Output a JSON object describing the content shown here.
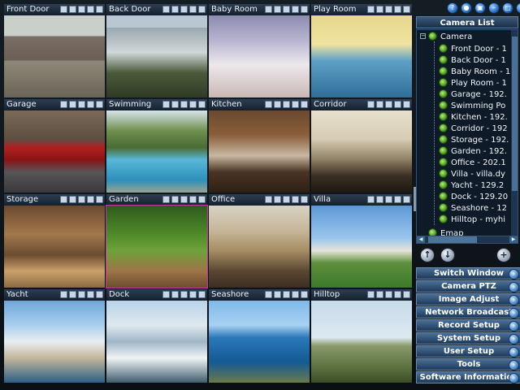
{
  "cameras": [
    {
      "name": "Front Door"
    },
    {
      "name": "Back Door"
    },
    {
      "name": "Baby Room"
    },
    {
      "name": "Play Room"
    },
    {
      "name": "Garage"
    },
    {
      "name": "Swimming"
    },
    {
      "name": "Kitchen"
    },
    {
      "name": "Corridor"
    },
    {
      "name": "Storage"
    },
    {
      "name": "Garden"
    },
    {
      "name": "Office"
    },
    {
      "name": "Villa"
    },
    {
      "name": "Yacht"
    },
    {
      "name": "Dock"
    },
    {
      "name": "Seashore"
    },
    {
      "name": "Hilltop"
    }
  ],
  "selected_camera": "Garden",
  "panel": {
    "title": "Camera List",
    "root": "Camera",
    "items": [
      "Front Door - 1",
      "Back Door - 1",
      "Baby Room - 1",
      "Play Room - 1",
      "Garage - 192.",
      "Swimming Po",
      "Kitchen - 192.",
      "Corridor - 192",
      "Storage - 192.",
      "Garden - 192.",
      "Office - 202.1",
      "Villa - villa.dy",
      "Yacht - 129.2",
      "Dock - 129.20",
      "Seashore - 12",
      "Hilltop - myhi"
    ],
    "cut_off_item": "Emap",
    "buttons": [
      "Switch Window",
      "Camera PTZ",
      "Image Adjust",
      "Network Broadcast",
      "Record Setup",
      "System Setup",
      "User Setup",
      "Tools",
      "Software Information"
    ]
  },
  "colors": {
    "selected_outline": "#c23aa4",
    "panel_button": "#2f5477",
    "camera_icon": "#5fb82a"
  }
}
